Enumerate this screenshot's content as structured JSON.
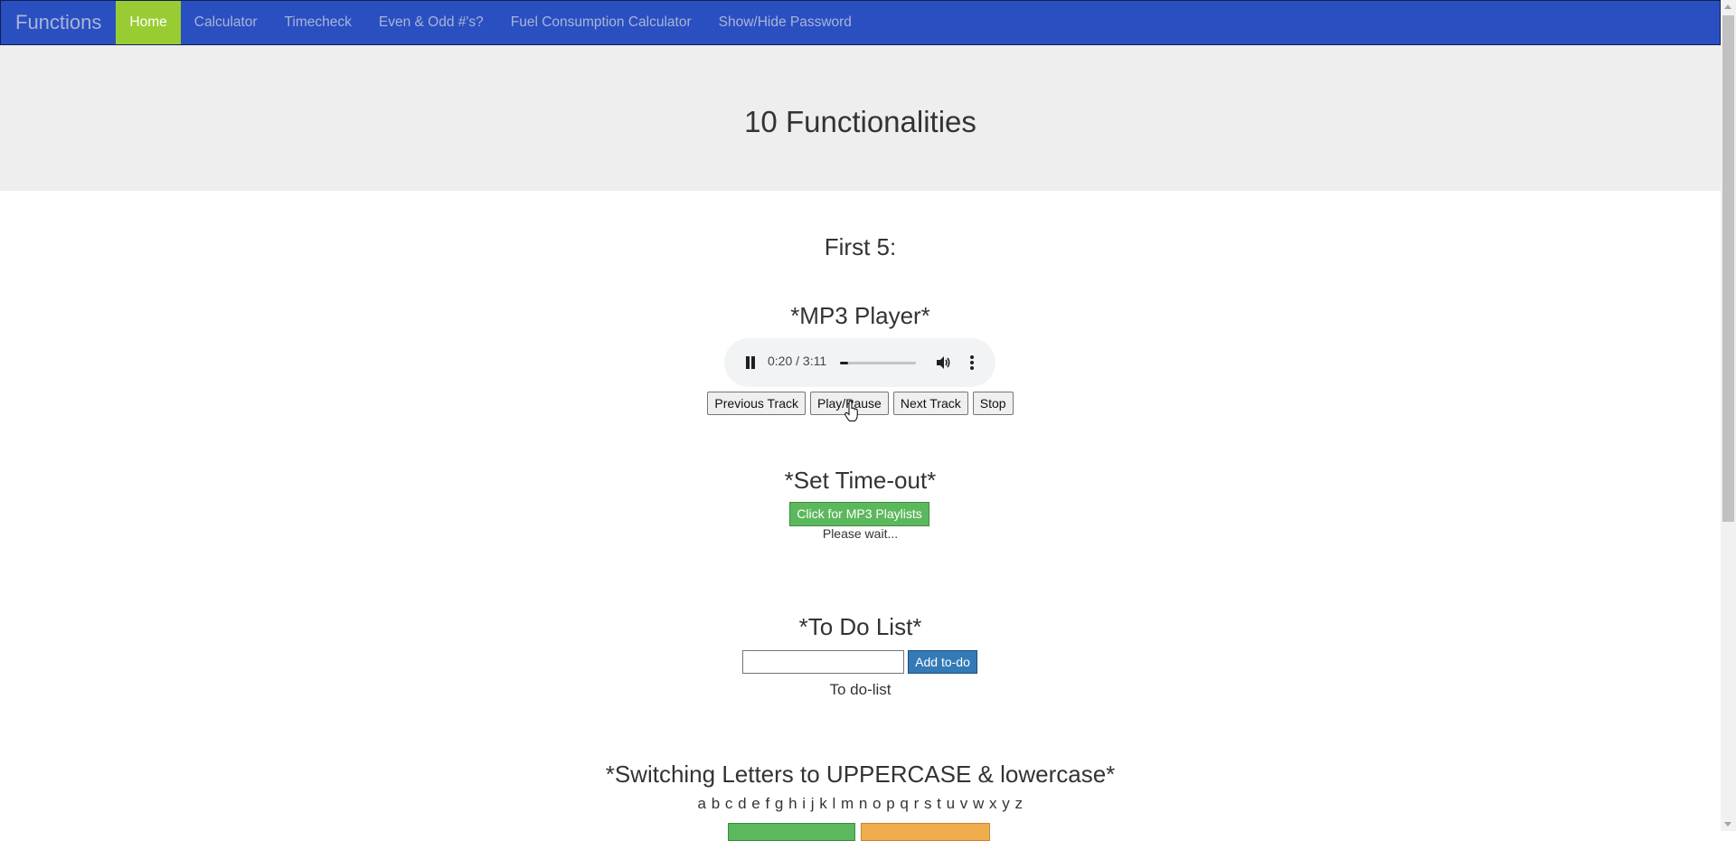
{
  "navbar": {
    "brand": "Functions",
    "items": [
      {
        "label": "Home",
        "active": true
      },
      {
        "label": "Calculator",
        "active": false
      },
      {
        "label": "Timecheck",
        "active": false
      },
      {
        "label": "Even & Odd #'s?",
        "active": false
      },
      {
        "label": "Fuel Consumption Calculator",
        "active": false
      },
      {
        "label": "Show/Hide Password",
        "active": false
      }
    ],
    "colors": {
      "background": "#2a4fc0",
      "active": "#99cc33"
    }
  },
  "jumbotron": {
    "title": "10 Functionalities"
  },
  "main": {
    "section_heading": "First 5:",
    "mp3": {
      "heading": "*MP3 Player*",
      "player": {
        "state": "playing",
        "time": "0:20 / 3:11",
        "progress": 0.105
      },
      "buttons": [
        "Previous Track",
        "Play/Pause",
        "Next Track",
        "Stop"
      ]
    },
    "timeout": {
      "heading": "*Set Time-out*",
      "button_label": "Click for MP3 Playlists",
      "status": "Please wait..."
    },
    "todo": {
      "heading": "*To Do List*",
      "input_value": "",
      "button_label": "Add to-do",
      "list_label": "To do-list"
    },
    "case_switch": {
      "heading": "*Switching Letters to UPPERCASE & lowercase*",
      "letters": "a b c d e f g h i j k l m n o p q r s t u v w x y z"
    }
  }
}
